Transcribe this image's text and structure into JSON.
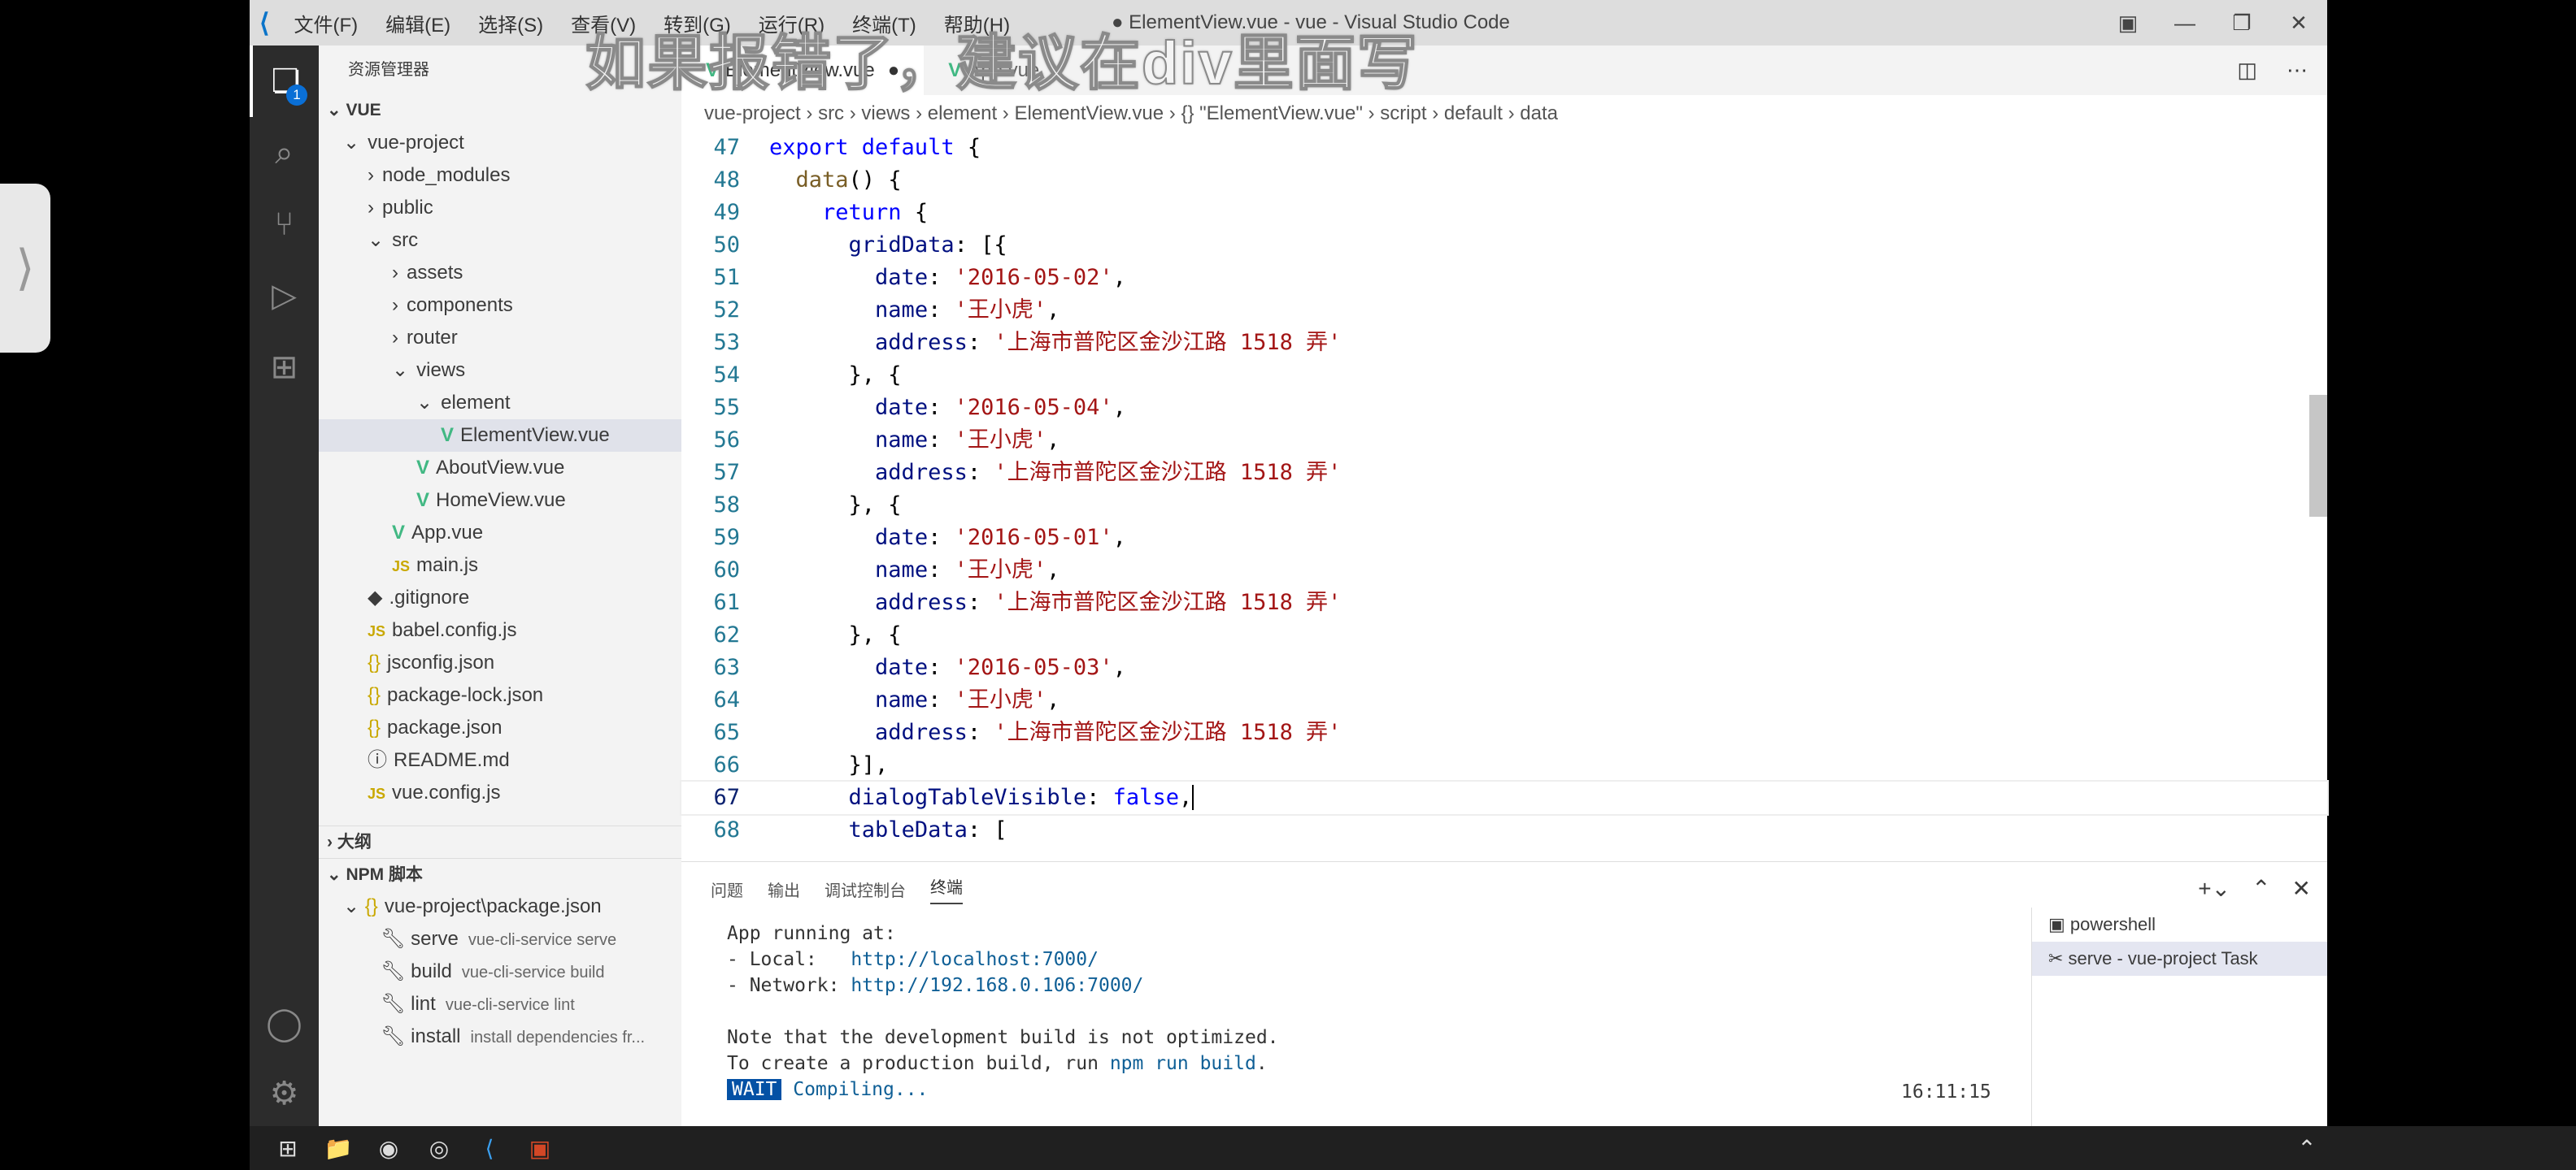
{
  "titlebar": {
    "menus": [
      "文件(F)",
      "编辑(E)",
      "选择(S)",
      "查看(V)",
      "转到(G)",
      "运行(R)",
      "终端(T)",
      "帮助(H)"
    ],
    "title": "● ElementView.vue - vue - Visual Studio Code"
  },
  "watermark": "如果报错了，建议在div里面写",
  "sidebar": {
    "header": "资源管理器",
    "root": "VUE",
    "tree": [
      {
        "label": "vue-project",
        "indent": 1,
        "type": "open"
      },
      {
        "label": "node_modules",
        "indent": 2,
        "type": "closed"
      },
      {
        "label": "public",
        "indent": 2,
        "type": "closed"
      },
      {
        "label": "src",
        "indent": 2,
        "type": "open"
      },
      {
        "label": "assets",
        "indent": 3,
        "type": "closed"
      },
      {
        "label": "components",
        "indent": 3,
        "type": "closed"
      },
      {
        "label": "router",
        "indent": 3,
        "type": "closed"
      },
      {
        "label": "views",
        "indent": 3,
        "type": "open"
      },
      {
        "label": "element",
        "indent": 4,
        "type": "open"
      },
      {
        "label": "ElementView.vue",
        "indent": 5,
        "type": "vue",
        "selected": true
      },
      {
        "label": "AboutView.vue",
        "indent": 4,
        "type": "vue"
      },
      {
        "label": "HomeView.vue",
        "indent": 4,
        "type": "vue"
      },
      {
        "label": "App.vue",
        "indent": 3,
        "type": "vue"
      },
      {
        "label": "main.js",
        "indent": 3,
        "type": "js"
      },
      {
        "label": ".gitignore",
        "indent": 2,
        "type": "git"
      },
      {
        "label": "babel.config.js",
        "indent": 2,
        "type": "js"
      },
      {
        "label": "jsconfig.json",
        "indent": 2,
        "type": "json"
      },
      {
        "label": "package-lock.json",
        "indent": 2,
        "type": "json"
      },
      {
        "label": "package.json",
        "indent": 2,
        "type": "json"
      },
      {
        "label": "README.md",
        "indent": 2,
        "type": "info"
      },
      {
        "label": "vue.config.js",
        "indent": 2,
        "type": "js"
      }
    ],
    "outline": "大纲",
    "npm": "NPM 脚本",
    "npm_pkg": "vue-project\\package.json",
    "scripts": [
      {
        "name": "serve",
        "cmd": "vue-cli-service serve"
      },
      {
        "name": "build",
        "cmd": "vue-cli-service build"
      },
      {
        "name": "lint",
        "cmd": "vue-cli-service lint"
      },
      {
        "name": "install",
        "cmd": "install dependencies fr..."
      }
    ]
  },
  "editor": {
    "tabs": [
      "ElementView.vue",
      "App.vue"
    ],
    "breadcrumb": [
      "vue-project",
      "src",
      "views",
      "element",
      "ElementView.vue",
      "{} \"ElementView.vue\"",
      "script",
      "default",
      "data"
    ],
    "lines": [
      {
        "n": "47",
        "t": [
          [
            "export default",
            "kw"
          ],
          [
            " {",
            "pl"
          ]
        ]
      },
      {
        "n": "48",
        "t": [
          [
            "  ",
            "pl"
          ],
          [
            "data",
            "fn"
          ],
          [
            "() {",
            "pl"
          ]
        ]
      },
      {
        "n": "49",
        "t": [
          [
            "    ",
            "pl"
          ],
          [
            "return",
            "kw"
          ],
          [
            " {",
            "pl"
          ]
        ]
      },
      {
        "n": "50",
        "t": [
          [
            "      ",
            "pl"
          ],
          [
            "gridData",
            "prop"
          ],
          [
            ": [{",
            "pl"
          ]
        ]
      },
      {
        "n": "51",
        "t": [
          [
            "        ",
            "pl"
          ],
          [
            "date",
            "prop"
          ],
          [
            ": ",
            "pl"
          ],
          [
            "'2016-05-02'",
            "str"
          ],
          [
            ",",
            "pl"
          ]
        ]
      },
      {
        "n": "52",
        "t": [
          [
            "        ",
            "pl"
          ],
          [
            "name",
            "prop"
          ],
          [
            ": ",
            "pl"
          ],
          [
            "'王小虎'",
            "str"
          ],
          [
            ",",
            "pl"
          ]
        ]
      },
      {
        "n": "53",
        "t": [
          [
            "        ",
            "pl"
          ],
          [
            "address",
            "prop"
          ],
          [
            ": ",
            "pl"
          ],
          [
            "'上海市普陀区金沙江路 1518 弄'",
            "str"
          ]
        ]
      },
      {
        "n": "54",
        "t": [
          [
            "      }, {",
            "pl"
          ]
        ]
      },
      {
        "n": "55",
        "t": [
          [
            "        ",
            "pl"
          ],
          [
            "date",
            "prop"
          ],
          [
            ": ",
            "pl"
          ],
          [
            "'2016-05-04'",
            "str"
          ],
          [
            ",",
            "pl"
          ]
        ]
      },
      {
        "n": "56",
        "t": [
          [
            "        ",
            "pl"
          ],
          [
            "name",
            "prop"
          ],
          [
            ": ",
            "pl"
          ],
          [
            "'王小虎'",
            "str"
          ],
          [
            ",",
            "pl"
          ]
        ]
      },
      {
        "n": "57",
        "t": [
          [
            "        ",
            "pl"
          ],
          [
            "address",
            "prop"
          ],
          [
            ": ",
            "pl"
          ],
          [
            "'上海市普陀区金沙江路 1518 弄'",
            "str"
          ]
        ]
      },
      {
        "n": "58",
        "t": [
          [
            "      }, {",
            "pl"
          ]
        ]
      },
      {
        "n": "59",
        "t": [
          [
            "        ",
            "pl"
          ],
          [
            "date",
            "prop"
          ],
          [
            ": ",
            "pl"
          ],
          [
            "'2016-05-01'",
            "str"
          ],
          [
            ",",
            "pl"
          ]
        ]
      },
      {
        "n": "60",
        "t": [
          [
            "        ",
            "pl"
          ],
          [
            "name",
            "prop"
          ],
          [
            ": ",
            "pl"
          ],
          [
            "'王小虎'",
            "str"
          ],
          [
            ",",
            "pl"
          ]
        ]
      },
      {
        "n": "61",
        "t": [
          [
            "        ",
            "pl"
          ],
          [
            "address",
            "prop"
          ],
          [
            ": ",
            "pl"
          ],
          [
            "'上海市普陀区金沙江路 1518 弄'",
            "str"
          ]
        ]
      },
      {
        "n": "62",
        "t": [
          [
            "      }, {",
            "pl"
          ]
        ]
      },
      {
        "n": "63",
        "t": [
          [
            "        ",
            "pl"
          ],
          [
            "date",
            "prop"
          ],
          [
            ": ",
            "pl"
          ],
          [
            "'2016-05-03'",
            "str"
          ],
          [
            ",",
            "pl"
          ]
        ]
      },
      {
        "n": "64",
        "t": [
          [
            "        ",
            "pl"
          ],
          [
            "name",
            "prop"
          ],
          [
            ": ",
            "pl"
          ],
          [
            "'王小虎'",
            "str"
          ],
          [
            ",",
            "pl"
          ]
        ]
      },
      {
        "n": "65",
        "t": [
          [
            "        ",
            "pl"
          ],
          [
            "address",
            "prop"
          ],
          [
            ": ",
            "pl"
          ],
          [
            "'上海市普陀区金沙江路 1518 弄'",
            "str"
          ]
        ]
      },
      {
        "n": "66",
        "t": [
          [
            "      }],",
            "pl"
          ]
        ]
      },
      {
        "n": "67",
        "t": [
          [
            "      ",
            "pl"
          ],
          [
            "dialogTableVisible",
            "prop"
          ],
          [
            ": ",
            "pl"
          ],
          [
            "false",
            "kw"
          ],
          [
            ",",
            "pl"
          ]
        ],
        "current": true
      },
      {
        "n": "68",
        "t": [
          [
            "      ",
            "pl"
          ],
          [
            "tableData",
            "prop"
          ],
          [
            ": [",
            "pl"
          ]
        ]
      }
    ]
  },
  "panel": {
    "tabs": [
      "问题",
      "输出",
      "调试控制台",
      "终端"
    ],
    "active": "终端",
    "term": {
      "l1": "App running at:",
      "l2a": "- Local:   ",
      "l2b": "http://localhost:7000/",
      "l3a": "- Network: ",
      "l3b": "http://192.168.0.106:7000/",
      "l4": "Note that the development build is not optimized.",
      "l5a": "To create a production build, run ",
      "l5b": "npm run build",
      "l5c": ".",
      "wait": "WAIT",
      "compiling": " Compiling...",
      "time": "16:11:15"
    },
    "terminals": [
      "powershell",
      "serve - vue-project Task"
    ]
  }
}
